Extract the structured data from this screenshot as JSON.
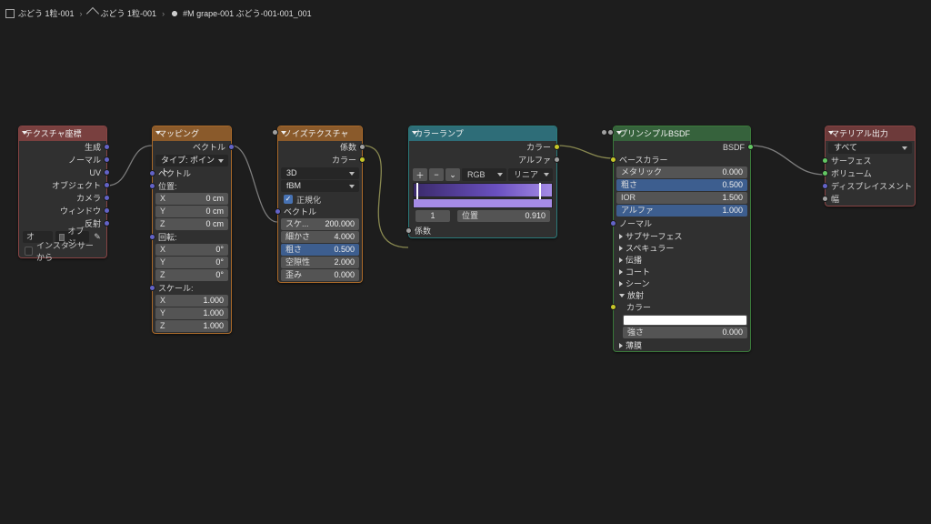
{
  "breadcrumb": {
    "items": [
      "ぶどう 1粒-001",
      "ぶどう 1粒-001",
      "#M grape-001 ぶどう-001-001_001"
    ]
  },
  "nodes": {
    "texcoord": {
      "title": "テクスチャ座標",
      "outputs": [
        "生成",
        "ノーマル",
        "UV",
        "オブジェクト",
        "カメラ",
        "ウィンドウ",
        "反射"
      ],
      "object_label": "オブ...",
      "object_field": "オブジ",
      "from_instancer": "インスタンサーから"
    },
    "mapping": {
      "title": "マッピング",
      "out_vector": "ベクトル",
      "type_label": "タイプ:",
      "type_value": "ポイント",
      "in_vector": "ベクトル",
      "loc_label": "位置:",
      "loc": {
        "x": [
          "X",
          "0 cm"
        ],
        "y": [
          "Y",
          "0 cm"
        ],
        "z": [
          "Z",
          "0 cm"
        ]
      },
      "rot_label": "回転:",
      "rot": {
        "x": [
          "X",
          "0°"
        ],
        "y": [
          "Y",
          "0°"
        ],
        "z": [
          "Z",
          "0°"
        ]
      },
      "scale_label": "スケール:",
      "scale": {
        "x": [
          "X",
          "1.000"
        ],
        "y": [
          "Y",
          "1.000"
        ],
        "z": [
          "Z",
          "1.000"
        ]
      }
    },
    "noise": {
      "title": "ノイズテクスチャ",
      "out_fac": "係数",
      "out_color": "カラー",
      "dim": "3D",
      "basis": "fBM",
      "normalize": "正規化",
      "in_vector": "ベクトル",
      "scale": [
        "スケ...",
        "200.000"
      ],
      "detail": [
        "細かさ",
        "4.000"
      ],
      "rough": [
        "粗さ",
        "0.500"
      ],
      "lacunarity": [
        "空隙性",
        "2.000"
      ],
      "distortion": [
        "歪み",
        "0.000"
      ]
    },
    "ramp": {
      "title": "カラーランプ",
      "out_color": "カラー",
      "out_alpha": "アルファ",
      "btn_add": "＋",
      "btn_sub": "−",
      "btn_menu": "⌄",
      "interp": "RGB",
      "mode": "リニア",
      "stop_index": "1",
      "pos_label": "位置",
      "pos_value": "0.910",
      "in_fac": "係数"
    },
    "bsdf": {
      "title": "プリンシプルBSDF",
      "out": "BSDF",
      "base_color": "ベースカラー",
      "metallic": [
        "メタリック",
        "0.000"
      ],
      "rough": [
        "粗さ",
        "0.500"
      ],
      "ior": [
        "IOR",
        "1.500"
      ],
      "alpha": [
        "アルファ",
        "1.000"
      ],
      "normal": "ノーマル",
      "subsurface": "サブサーフェス",
      "specular": "スペキュラー",
      "transmission": "伝播",
      "coat": "コート",
      "sheen": "シーン",
      "emission": "放射",
      "emit_color": "カラー",
      "emit_strength": [
        "強さ",
        "0.000"
      ],
      "thinfilm": "薄膜"
    },
    "output": {
      "title": "マテリアル出力",
      "target": "すべて",
      "surface": "サーフェス",
      "volume": "ボリューム",
      "displacement": "ディスプレイスメント",
      "thickness": "幅"
    }
  }
}
